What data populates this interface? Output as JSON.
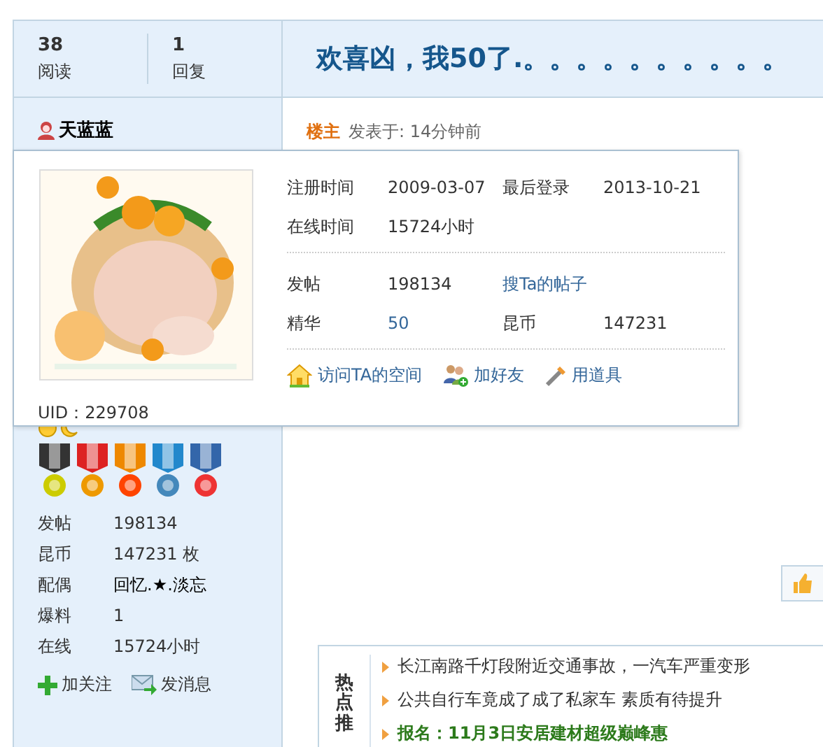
{
  "header": {
    "stats": [
      {
        "value": "38",
        "label": "阅读"
      },
      {
        "value": "1",
        "label": "回复"
      }
    ],
    "title": "欢喜凶，我50了.。。。。。。。。。。"
  },
  "author": {
    "name": "天蓝蓝",
    "stats": [
      {
        "label": "发帖",
        "value": "198134"
      },
      {
        "label": "昆币",
        "value": "147231 枚"
      },
      {
        "label": "配偶",
        "value": "回忆.★.淡忘"
      },
      {
        "label": "爆料",
        "value": "1"
      },
      {
        "label": "在线",
        "value": "15724小时"
      }
    ],
    "actions": [
      {
        "kind": "follow",
        "label": "加关注"
      },
      {
        "kind": "message",
        "label": "发消息"
      }
    ]
  },
  "post": {
    "role": "楼主",
    "posted": "发表于: 14分钟前"
  },
  "profile_card": {
    "avatar": {
      "kind": "picture"
    },
    "sections": [
      [
        [
          {
            "kind": "label",
            "text": "注册时间"
          },
          {
            "kind": "value",
            "text": "2009-03-07"
          },
          {
            "kind": "label",
            "text": "最后登录"
          },
          {
            "kind": "value",
            "text": "2013-10-21"
          }
        ],
        [
          {
            "kind": "label",
            "text": "在线时间"
          },
          {
            "kind": "value",
            "text": "15724小时"
          }
        ]
      ],
      [
        [
          {
            "kind": "label",
            "text": "发帖"
          },
          {
            "kind": "value",
            "text": "198134"
          },
          {
            "kind": "link",
            "text": "搜Ta的帖子"
          }
        ],
        [
          {
            "kind": "label",
            "text": "精华"
          },
          {
            "kind": "link",
            "text": "50"
          },
          {
            "kind": "label",
            "text": "昆币"
          },
          {
            "kind": "value",
            "text": "147231"
          }
        ]
      ]
    ],
    "actions": [
      {
        "kind": "home",
        "label": "访问TA的空间"
      },
      {
        "kind": "friend",
        "label": "加好友"
      },
      {
        "kind": "tool",
        "label": "用道具"
      }
    ],
    "uid": "UID：229708"
  },
  "hot": {
    "title": "热点推",
    "items": [
      {
        "text": "长江南路千灯段附近交通事故，一汽车严重变形",
        "highlight": false
      },
      {
        "text": "公共自行车竟成了成了私家车 素质有待提升",
        "highlight": false
      },
      {
        "text": "报名：11月3日安居建材超级巅峰惠",
        "highlight": true
      }
    ]
  }
}
